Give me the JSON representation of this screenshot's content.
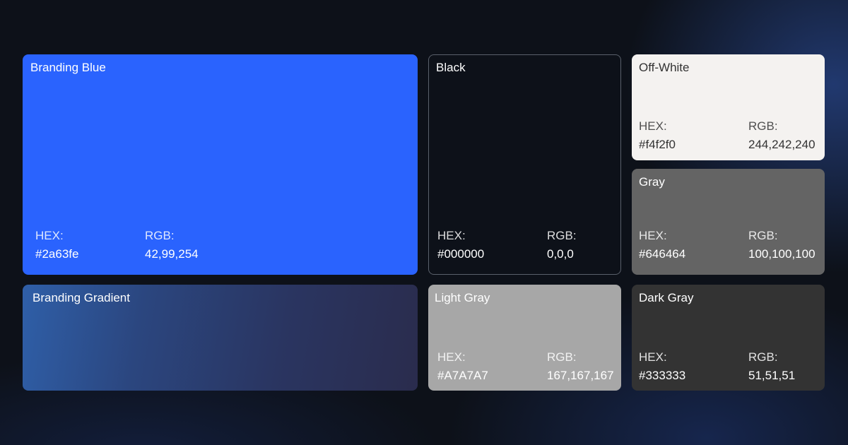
{
  "hex_label": "HEX:",
  "rgb_label": "RGB:",
  "swatches": {
    "branding_blue": {
      "name": "Branding Blue",
      "hex": "#2a63fe",
      "rgb": "42,99,254"
    },
    "black": {
      "name": "Black",
      "hex": "#000000",
      "rgb": "0,0,0"
    },
    "off_white": {
      "name": "Off-White",
      "hex": "#f4f2f0",
      "rgb": "244,242,240"
    },
    "gray": {
      "name": "Gray",
      "hex": "#646464",
      "rgb": "100,100,100"
    },
    "branding_gradient": {
      "name": "Branding Gradient"
    },
    "light_gray": {
      "name": "Light Gray",
      "hex": "#A7A7A7",
      "rgb": "167,167,167"
    },
    "dark_gray": {
      "name": "Dark Gray",
      "hex": "#333333",
      "rgb": "51,51,51"
    }
  }
}
